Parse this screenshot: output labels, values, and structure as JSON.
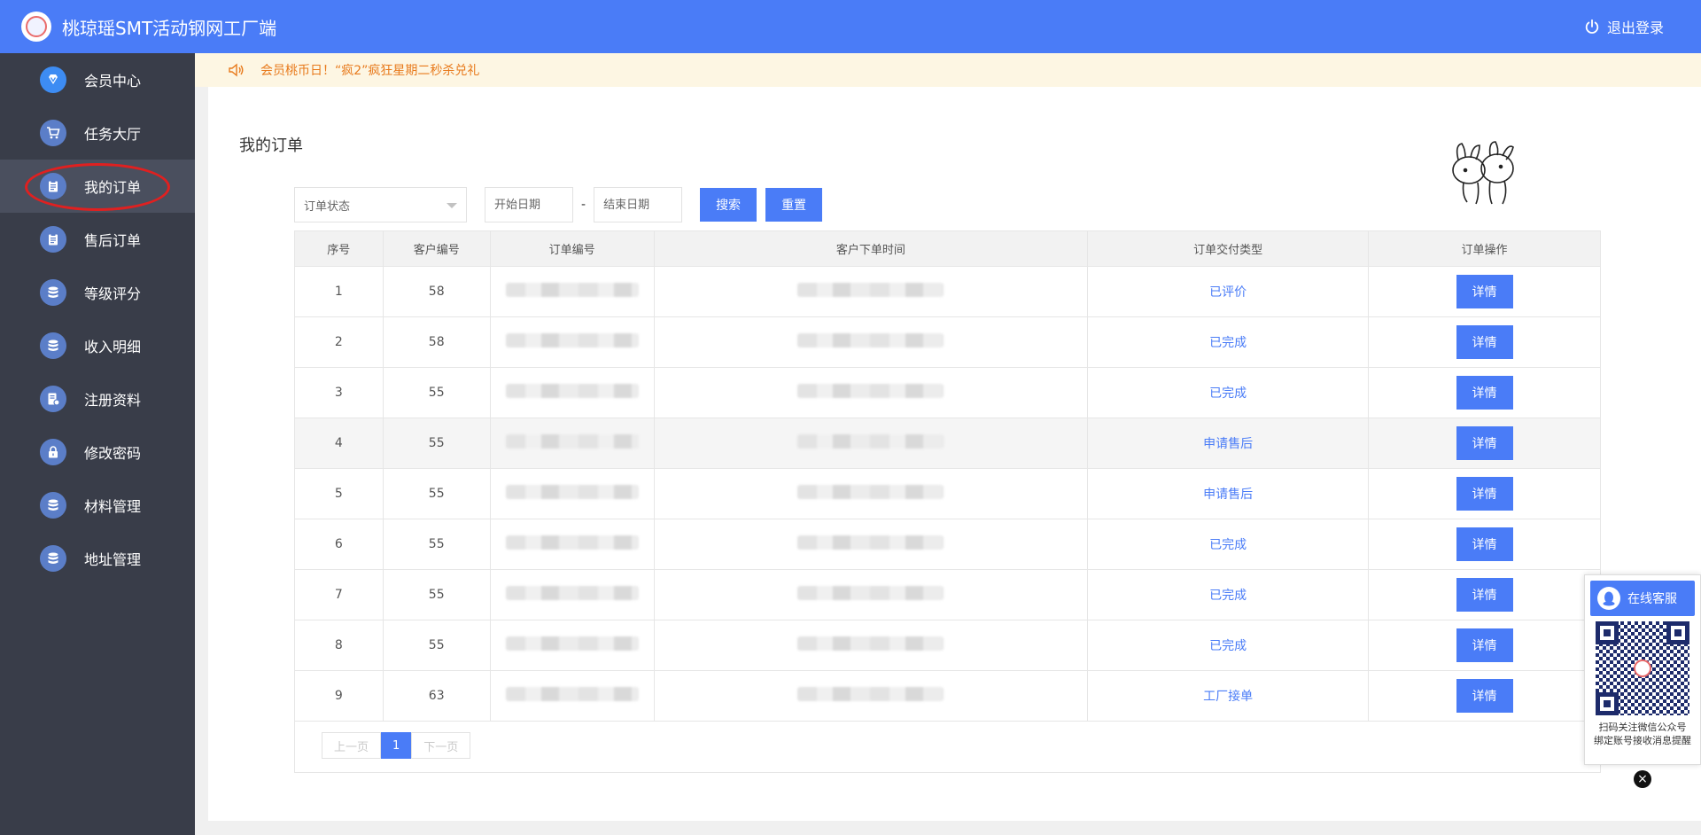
{
  "header": {
    "app_title": "桃琼瑶SMT活动钢网工厂端",
    "logout_label": "退出登录"
  },
  "sidebar": {
    "items": [
      {
        "label": "会员中心",
        "icon": "diamond-icon"
      },
      {
        "label": "任务大厅",
        "icon": "cart-icon"
      },
      {
        "label": "我的订单",
        "icon": "clipboard-icon"
      },
      {
        "label": "售后订单",
        "icon": "clipboard-icon"
      },
      {
        "label": "等级评分",
        "icon": "database-icon"
      },
      {
        "label": "收入明细",
        "icon": "database-icon"
      },
      {
        "label": "注册资料",
        "icon": "document-icon"
      },
      {
        "label": "修改密码",
        "icon": "lock-icon"
      },
      {
        "label": "材料管理",
        "icon": "database-icon"
      },
      {
        "label": "地址管理",
        "icon": "database-icon"
      }
    ],
    "active_index": 2
  },
  "notice": {
    "text": "会员桃币日！“疯2”疯狂星期二秒杀兑礼"
  },
  "main": {
    "title": "我的订单"
  },
  "filters": {
    "status_placeholder": "订单状态",
    "start_date_placeholder": "开始日期",
    "end_date_placeholder": "结束日期",
    "separator": "-",
    "search_label": "搜索",
    "reset_label": "重置"
  },
  "table": {
    "columns": [
      "序号",
      "客户编号",
      "订单编号",
      "客户下单时间",
      "订单交付类型",
      "订单操作"
    ],
    "detail_label": "详情",
    "rows": [
      {
        "index": "1",
        "customer_id": "58",
        "status": "已评价"
      },
      {
        "index": "2",
        "customer_id": "58",
        "status": "已完成"
      },
      {
        "index": "3",
        "customer_id": "55",
        "status": "已完成"
      },
      {
        "index": "4",
        "customer_id": "55",
        "status": "申请售后"
      },
      {
        "index": "5",
        "customer_id": "55",
        "status": "申请售后"
      },
      {
        "index": "6",
        "customer_id": "55",
        "status": "已完成"
      },
      {
        "index": "7",
        "customer_id": "55",
        "status": "已完成"
      },
      {
        "index": "8",
        "customer_id": "55",
        "status": "已完成"
      },
      {
        "index": "9",
        "customer_id": "63",
        "status": "工厂接单"
      }
    ],
    "highlighted_row": 3
  },
  "pagination": {
    "prev_label": "上一页",
    "current_page": "1",
    "next_label": "下一页"
  },
  "service_widget": {
    "button_label": "在线客服",
    "qr_caption_line1": "扫码关注微信公众号",
    "qr_caption_line2": "绑定账号接收消息提醒",
    "close_label": "×"
  },
  "colors": {
    "primary": "#4a7cf7",
    "sidebar_bg": "#393d49",
    "notice_text": "#e87a1c",
    "annotation_ring": "#e02020"
  }
}
